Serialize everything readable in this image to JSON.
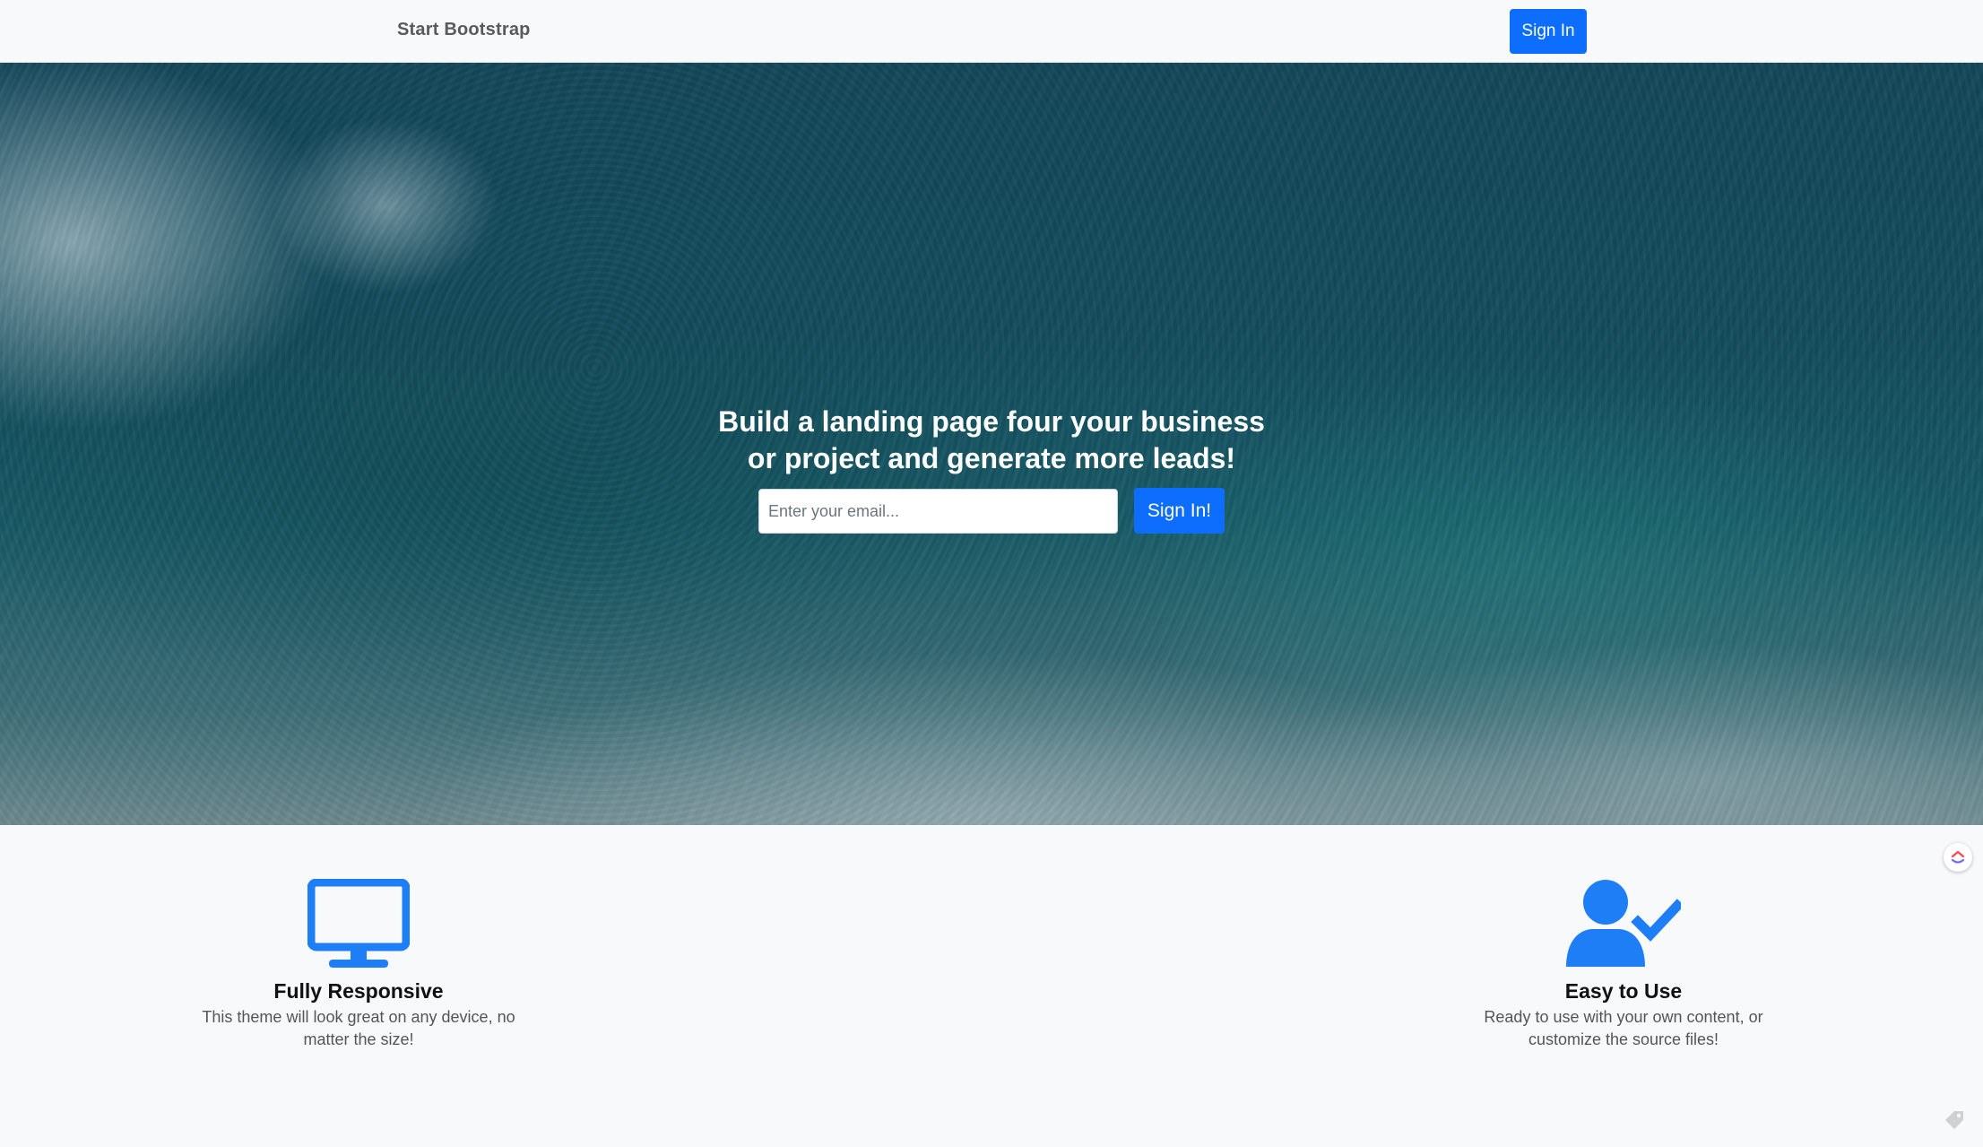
{
  "navbar": {
    "brand": "Start Bootstrap",
    "signin_label": "Sign In"
  },
  "hero": {
    "title_line1": "Build a landing page four your business",
    "title_line2": "or project and generate more leads!",
    "email_placeholder": "Enter your email...",
    "email_value": "",
    "signin_label": "Sign In!",
    "background": "ocean-waves-aerial-photo"
  },
  "features": [
    {
      "icon": "desktop-monitor-icon",
      "title": "Fully Responsive",
      "text": "This theme will look great on any device, no matter the size!"
    },
    {
      "icon": "user-check-icon",
      "title": "Easy to Use",
      "text": "Ready to use with your own content, or customize the source files!"
    }
  ],
  "widgets": {
    "floating_icon": "clickup-logo-icon",
    "corner_icon": "tag-icon"
  },
  "colors": {
    "primary": "#0d6efd",
    "icon_blue": "#1e7ef6",
    "navbar_bg": "#f8f9fa"
  }
}
